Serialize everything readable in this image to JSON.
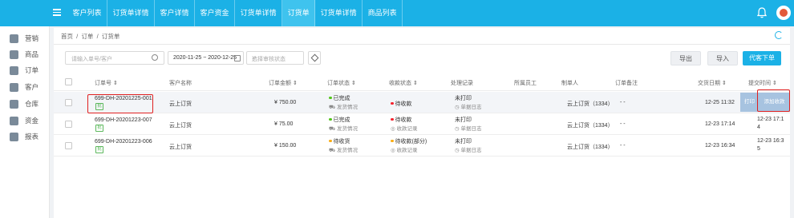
{
  "topnav": {
    "tabs": [
      {
        "label": "客户列表",
        "active": false
      },
      {
        "label": "订货单详情",
        "active": false
      },
      {
        "label": "客户详情",
        "active": false
      },
      {
        "label": "客户资金",
        "active": false
      },
      {
        "label": "订货单详情",
        "active": false
      },
      {
        "label": "订货单",
        "active": true
      },
      {
        "label": "订货单详情",
        "active": false
      },
      {
        "label": "商品列表",
        "active": false
      }
    ]
  },
  "sidebar": {
    "items": [
      {
        "label": "营销",
        "icon": "marketing-icon"
      },
      {
        "label": "商品",
        "icon": "goods-icon"
      },
      {
        "label": "订单",
        "icon": "order-icon"
      },
      {
        "label": "客户",
        "icon": "customer-icon"
      },
      {
        "label": "仓库",
        "icon": "warehouse-icon"
      },
      {
        "label": "资金",
        "icon": "funds-icon"
      },
      {
        "label": "报表",
        "icon": "report-icon"
      }
    ]
  },
  "breadcrumb": {
    "home": "首页",
    "sep1": "/",
    "level1": "订单",
    "sep2": "/",
    "current": "订货单"
  },
  "toolbar": {
    "search_placeholder": "请输入单号/客户",
    "date_range": "2020-11-25 ~ 2020-12-25",
    "status_placeholder": "选择审核状态",
    "export_label": "导出",
    "import_label": "导入",
    "create_label": "代客下单"
  },
  "table": {
    "headers": {
      "order_no": "订单号 ⇕",
      "customer": "客户名称",
      "amount": "订单金额 ⇕",
      "status": "订单状态 ⇕",
      "pay_status": "收款状态 ⇕",
      "process": "处理记录",
      "staff": "所属员工",
      "creator": "制单人",
      "remark": "订单备注",
      "deliver_date": "交货日期 ⇕",
      "submit_time": "提交时间 ⇕"
    },
    "rows": [
      {
        "order_no": "699-DH-20201225-001",
        "tag": "批",
        "customer": "云上订货",
        "amount": "¥ 750.00",
        "status": "已完成",
        "status_color": "#52c41a",
        "status_sub": "发货情况",
        "pay": "待收款",
        "pay_color": "#f5222d",
        "pay_sub": "",
        "process": "未打印",
        "process_sub": "单据日志",
        "creator": "云上订货（1334）",
        "remark": "- -",
        "deliver": "12-25 11:32",
        "submit": "",
        "print_label": "打印",
        "add_pay_label": "添加收款"
      },
      {
        "order_no": "699-DH-20201223-007",
        "tag": "批",
        "customer": "云上订货",
        "amount": "¥ 75.00",
        "status": "已完成",
        "status_color": "#52c41a",
        "status_sub": "发货情况",
        "pay": "待收款",
        "pay_color": "#f5222d",
        "pay_sub": "收款记录",
        "process": "未打印",
        "process_sub": "单据日志",
        "creator": "云上订货（1334）",
        "remark": "- -",
        "deliver": "12-23 17:14",
        "submit_line1": "12-23 17:1",
        "submit_line2": "4"
      },
      {
        "order_no": "699-DH-20201223-006",
        "tag": "批",
        "customer": "云上订货",
        "amount": "¥ 150.00",
        "status": "待收货",
        "status_color": "#faad14",
        "status_sub": "发货情况",
        "pay": "待收款(部分)",
        "pay_color": "#faad14",
        "pay_sub": "收款记录",
        "process": "未打印",
        "process_sub": "单据日志",
        "creator": "云上订货（1334）",
        "remark": "- -",
        "deliver": "12-23 16:34",
        "submit_line1": "12-23 16:3",
        "submit_line2": "5"
      }
    ]
  },
  "colors": {
    "brand": "#1bb1e6",
    "highlight_box": "#e02020"
  }
}
